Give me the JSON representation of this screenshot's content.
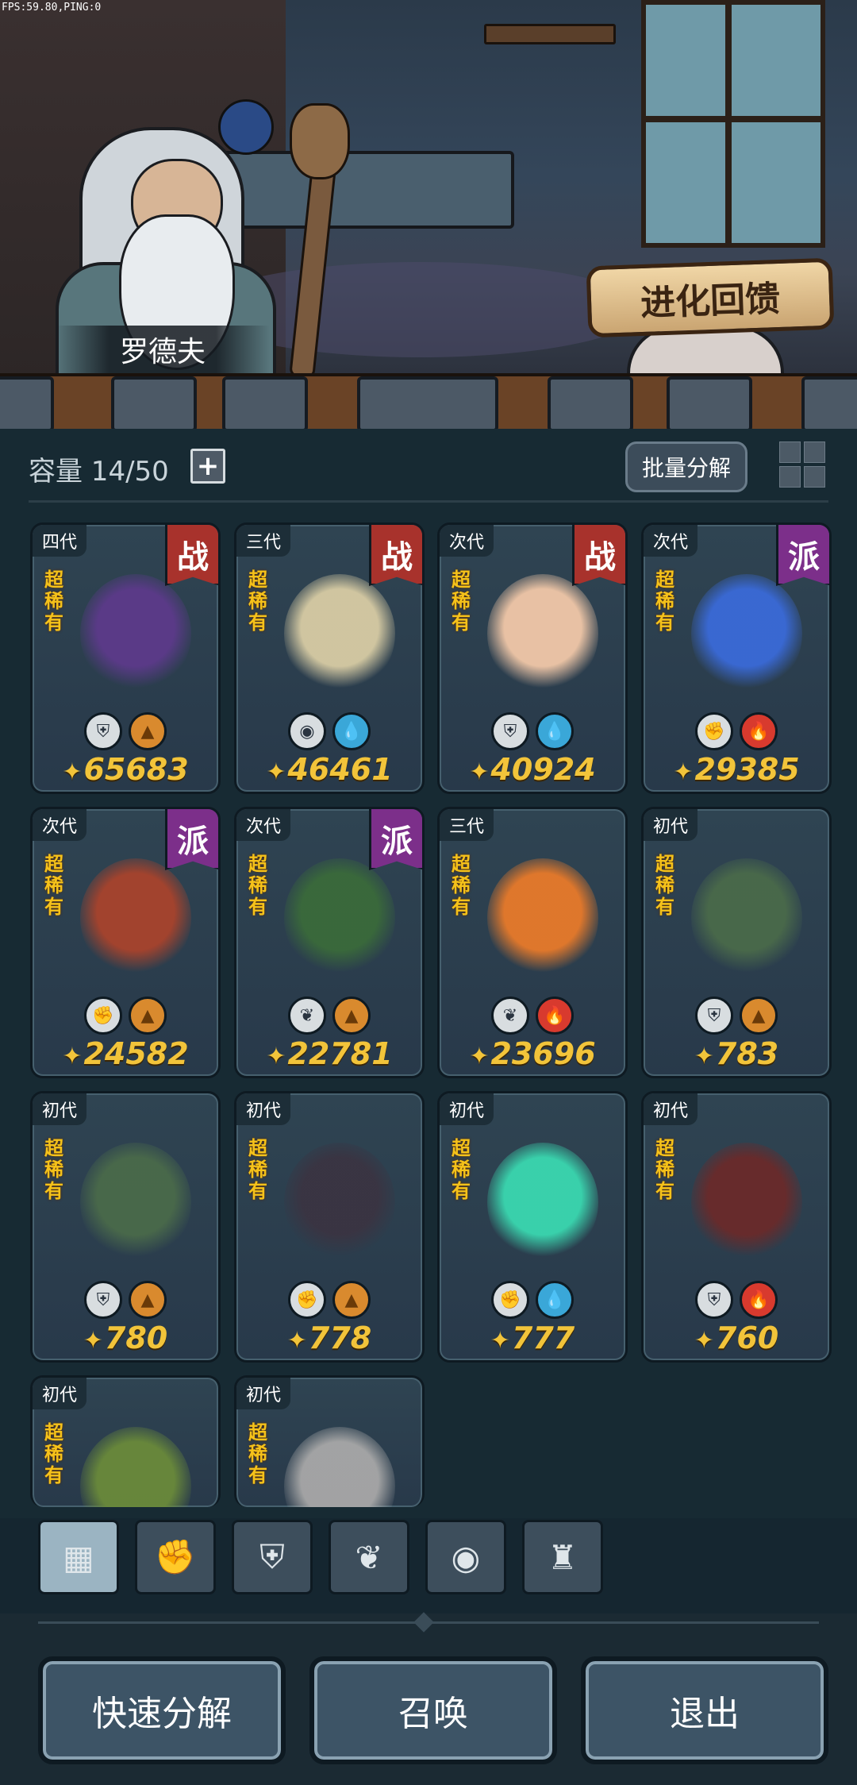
{
  "debug": {
    "fps_ping": "FPS:59.80,PING:0"
  },
  "scene": {
    "npc_name": "罗德夫",
    "evolution_button": "进化回馈"
  },
  "header": {
    "capacity": "容量 14/50",
    "add_symbol": "+",
    "batch_decompose": "批量分解"
  },
  "rarity_label": "超稀有",
  "cards": [
    {
      "gen": "四代",
      "badge": "战",
      "power": "65683",
      "elements": [
        "guard",
        "earth"
      ]
    },
    {
      "gen": "三代",
      "badge": "战",
      "power": "46461",
      "elements": [
        "alien",
        "water"
      ]
    },
    {
      "gen": "次代",
      "badge": "战",
      "power": "40924",
      "elements": [
        "guard",
        "water"
      ]
    },
    {
      "gen": "次代",
      "badge": "派",
      "power": "29385",
      "elements": [
        "fist",
        "fire"
      ]
    },
    {
      "gen": "次代",
      "badge": "派",
      "power": "24582",
      "elements": [
        "fist",
        "earth"
      ]
    },
    {
      "gen": "次代",
      "badge": "派",
      "power": "22781",
      "elements": [
        "leaf",
        "earth"
      ]
    },
    {
      "gen": "三代",
      "badge": "",
      "power": "23696",
      "elements": [
        "leaf",
        "fire"
      ]
    },
    {
      "gen": "初代",
      "badge": "",
      "power": "783",
      "elements": [
        "guard",
        "earth"
      ]
    },
    {
      "gen": "初代",
      "badge": "",
      "power": "780",
      "elements": [
        "guard",
        "earth"
      ]
    },
    {
      "gen": "初代",
      "badge": "",
      "power": "778",
      "elements": [
        "fist",
        "earth"
      ]
    },
    {
      "gen": "初代",
      "badge": "",
      "power": "777",
      "elements": [
        "fist",
        "water"
      ]
    },
    {
      "gen": "初代",
      "badge": "",
      "power": "760",
      "elements": [
        "guard",
        "fire"
      ]
    },
    {
      "gen": "初代",
      "badge": "",
      "power": "",
      "elements": []
    },
    {
      "gen": "初代",
      "badge": "",
      "power": "",
      "elements": []
    }
  ],
  "filters": [
    "all",
    "fist",
    "guard",
    "leaf",
    "alien",
    "tower"
  ],
  "buttons": {
    "quick_decompose": "快速分解",
    "summon": "召唤",
    "exit": "退出"
  }
}
